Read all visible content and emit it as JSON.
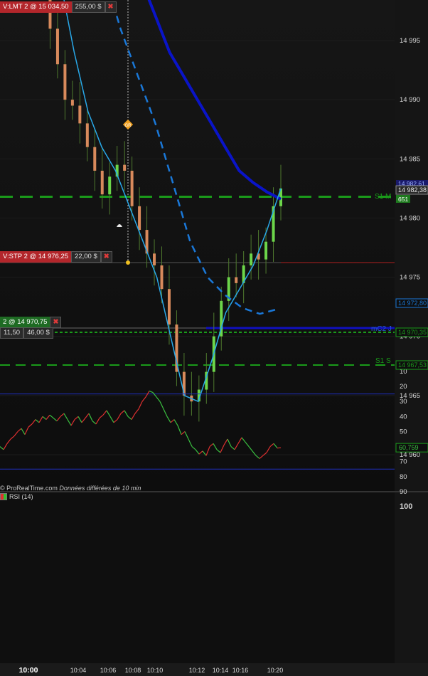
{
  "chart_data": [
    {
      "type": "candlestick",
      "source": "© ProRealTime.com",
      "source_note": "Données différées de 10 min",
      "ylim": [
        14956,
        15000
      ],
      "y_ticks": [
        "14 995",
        "14 990",
        "14 985",
        "14 980",
        "14 975",
        "14 970",
        "14 965",
        "14 960"
      ],
      "x_ticks": [
        "10:00",
        "10:04",
        "10:06",
        "10:08",
        "10:10",
        "10:12",
        "10:14",
        "10:16",
        "10:20"
      ],
      "closes": [
        15001,
        14996,
        14993,
        14990,
        14989.5,
        14988,
        14986,
        14984,
        14982,
        14983.5,
        14984.5,
        14984,
        14981,
        14979,
        14977,
        14976,
        14974,
        14971,
        14967,
        14965,
        14964.5,
        14965.5,
        14967,
        14970,
        14973,
        14975,
        14974.5,
        14976,
        14977,
        14976.5,
        14978,
        14981,
        14982.5
      ],
      "moving_averages": [
        {
          "color": "#0a14c8",
          "style": "solid",
          "values": [
            15004,
            15000,
            14997,
            14994,
            14992,
            14990,
            14988,
            14986,
            14984,
            14983,
            14982.2,
            14981.6
          ]
        },
        {
          "color": "#1a78d8",
          "style": "dashed",
          "values": [
            15001,
            14996,
            14992,
            14988,
            14983,
            14978,
            14975,
            14973.5,
            14972.4,
            14971.9,
            14972.3
          ]
        },
        {
          "color": "#29a8e8",
          "style": "solid",
          "values": [
            15000,
            14994,
            14989,
            14986,
            14984,
            14981,
            14978,
            14975,
            14970,
            14965,
            14964.5,
            14968,
            14972,
            14974,
            14976,
            14979,
            14982.5
          ]
        }
      ],
      "levels": [
        {
          "label": "S1 M",
          "price": 14981.8,
          "color": "#1a9a1a",
          "value_text": ""
        },
        {
          "label": "",
          "price": 14976.25,
          "color": "#b02020",
          "value_text": ""
        },
        {
          "label": "mC2 J",
          "price": 14970.75,
          "color": "#1010c0",
          "value_text": "14 970,75"
        },
        {
          "label": "",
          "price": 14970.35,
          "color": "#1a9a1a",
          "value_text": "14 970,35"
        },
        {
          "label": "S1 S",
          "price": 14967.53,
          "color": "#1a9a1a",
          "value_text": "14 967,53"
        },
        {
          "label": "",
          "price": 14972.8,
          "color": "#1a78d8",
          "value_text": "14 972,80"
        }
      ],
      "price_tags": [
        {
          "text": "14 982,38",
          "price": 14982.38,
          "bg": "#2a2a2a",
          "fg": "#e8e8e8"
        },
        {
          "text": "651",
          "price": 14981.9,
          "bg": "#1e7a1e",
          "fg": "#ffffff"
        },
        {
          "text": "14 982,61",
          "price": 14983.2,
          "bg": "#1a1a6a",
          "fg": "#9ab0ff"
        }
      ],
      "markers": [
        "GR"
      ]
    },
    {
      "type": "line",
      "title": "RSI (14)",
      "ylim": [
        0,
        105
      ],
      "y_ticks": [
        100,
        90,
        80,
        70,
        60,
        50,
        40,
        30,
        20,
        10
      ],
      "overbought": 75,
      "oversold": 25,
      "last_value": "60,759",
      "values": [
        60,
        62,
        58,
        55,
        53,
        50,
        48,
        52,
        47,
        45,
        42,
        44,
        40,
        42,
        39,
        41,
        43,
        40,
        38,
        42,
        46,
        42,
        40,
        44,
        41,
        38,
        43,
        45,
        41,
        39,
        36,
        40,
        44,
        42,
        38,
        36,
        40,
        42,
        38,
        35,
        30,
        27,
        23,
        24,
        27,
        30,
        35,
        40,
        44,
        42,
        46,
        52,
        50,
        55,
        60,
        62,
        65,
        63,
        66,
        60,
        58,
        62,
        64,
        59,
        55,
        60,
        62,
        58,
        54,
        57,
        60,
        63,
        66,
        68,
        66,
        64,
        60,
        58,
        61,
        60.76
      ]
    }
  ],
  "orders": [
    {
      "label": "V:LMT 2 @ 15 034,50",
      "value": "255,00 $",
      "close": "✖"
    },
    {
      "label": "V:STP 2 @ 14 976,25",
      "value": "22,00 $",
      "close": "✖"
    },
    {
      "label": "2 @ 14 970,75",
      "value": "46,00 $",
      "qty": "11,50",
      "close": "✖"
    }
  ],
  "colors": {
    "bull": "#6cd64a",
    "bear": "#d88a5c",
    "wick": "#4f7a2e",
    "rsi_up": "#3ac040",
    "rsi_down": "#e03030"
  }
}
